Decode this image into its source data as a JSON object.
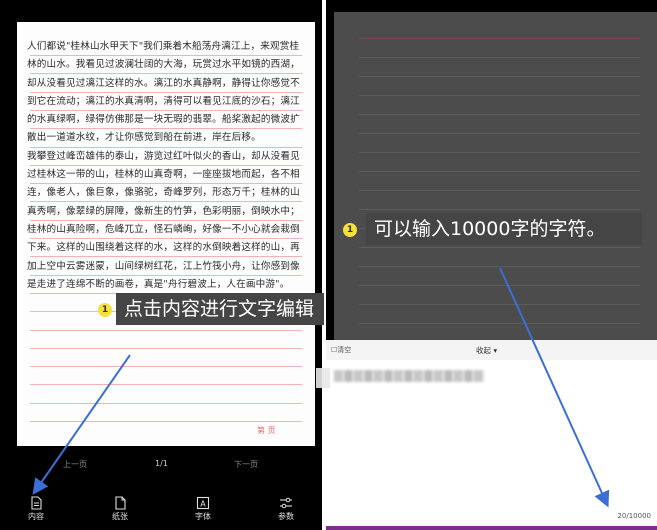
{
  "left": {
    "paragraph_text": "人们都说\"桂林山水甲天下\"我们乘着木船荡舟漓江上，来观赏桂林的山水。我看见过波澜壮阔的大海，玩赏过水平如镜的西湖，却从没看见过漓江这样的水。漓江的水真静啊，静得让你感觉不到它在流动；漓江的水真清啊，清得可以看见江底的沙石；漓江的水真绿啊，绿得仿佛那是一块无瑕的翡翠。船桨激起的微波扩散出一道道水纹，才让你感觉到船在前进，岸在后移。\n我攀登过峰峦雄伟的泰山，游览过红叶似火的香山，却从没看见过桂林这一带的山，桂林的山真奇啊，一座座拔地而起，各不相连，像老人，像巨象，像骆驼，奇峰罗列，形态万千；桂林的山真秀啊，像翠绿的屏障，像新生的竹笋，色彩明丽，倒映水中；桂林的山真险啊，危峰兀立，怪石嶙峋，好像一不小心就会栽倒下来。这样的山围绕着这样的水，这样的水倒映着这样的山，再加上空中云雾迷蒙，山间绿树红花，江上竹筏小舟，让你感到像是走进了连绵不断的画卷，真是\"舟行碧波上，人在画中游\"。",
    "page_label": "第    页",
    "pager": {
      "prev": "上一页",
      "count": "1/1",
      "next": "下一页"
    },
    "nav": [
      {
        "label": "内容",
        "icon": "document-icon"
      },
      {
        "label": "纸张",
        "icon": "paper-icon"
      },
      {
        "label": "字体",
        "icon": "font-icon"
      },
      {
        "label": "参数",
        "icon": "settings-sliders-icon"
      }
    ],
    "callout": {
      "badge": "1",
      "text": "点击内容进行文字编辑"
    }
  },
  "right": {
    "callout": {
      "badge": "1",
      "text": "可以输入10000字的字符。"
    },
    "editor": {
      "clear_label": "☐清空",
      "collapse_label": "收起  ▾",
      "char_count": "20/10000"
    }
  },
  "colors": {
    "callout_bg": "#454545",
    "badge": "#f5e13a",
    "arrow": "#3b6fd6",
    "ruled_line": "#f2b3b3"
  }
}
